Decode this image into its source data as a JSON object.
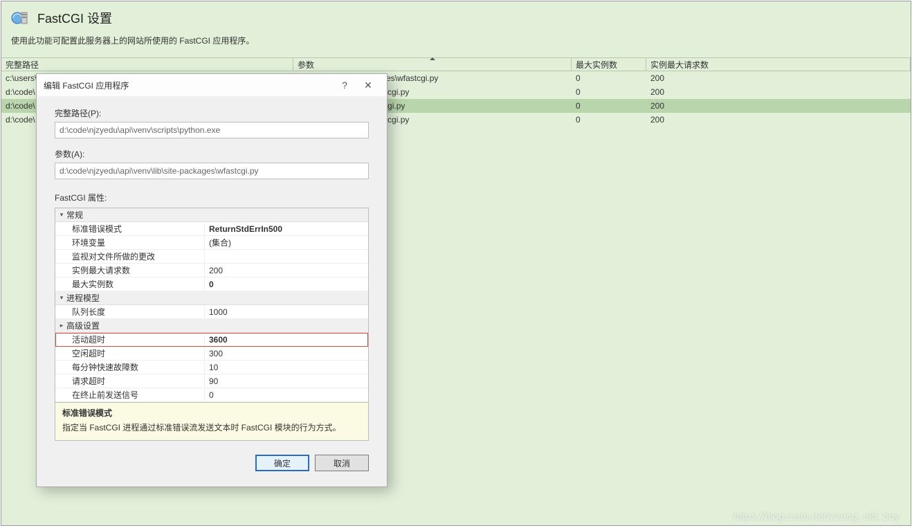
{
  "main": {
    "title": "FastCGI 设置",
    "description": "使用此功能可配置此服务器上的网站所使用的 FastCGI 应用程序。",
    "columns": [
      "完整路径",
      "参数",
      "最大实例数",
      "实例最大请求数"
    ],
    "sorted_col_index": 1,
    "rows": [
      {
        "path": "c:\\users\\",
        "args_suffix": "\\api\\venv\\lib\\site-packages\\wfastcgi.py",
        "max_instances": "0",
        "max_requests": "200",
        "selected": false
      },
      {
        "path": "d:\\code\\",
        "args_suffix": "v\\lib\\site-packages\\wfastcgi.py",
        "max_instances": "0",
        "max_requests": "200",
        "selected": false
      },
      {
        "path": "d:\\code\\",
        "args_suffix": "\\lib\\site-packages\\wfastcgi.py",
        "max_instances": "0",
        "max_requests": "200",
        "selected": true
      },
      {
        "path": "d:\\code\\",
        "args_suffix": "v\\lib\\site-packages\\wfastcgi.py",
        "max_instances": "0",
        "max_requests": "200",
        "selected": false
      }
    ]
  },
  "dialog": {
    "title": "编辑 FastCGI 应用程序",
    "help_glyph": "?",
    "close_glyph": "✕",
    "full_path_label": "完整路径(P):",
    "full_path_value": "d:\\code\\njzyedu\\api\\venv\\scripts\\python.exe",
    "args_label": "参数(A):",
    "args_value": "d:\\code\\njzyedu\\api\\venv\\lib\\site-packages\\wfastcgi.py",
    "props_label": "FastCGI 属性:",
    "cat_general": "常规",
    "cat_process": "进程模型",
    "cat_advanced": "高级设置",
    "props_general": [
      {
        "name": "标准错误模式",
        "value": "ReturnStdErrIn500",
        "bold": true
      },
      {
        "name": "环境变量",
        "value": "(集合)"
      },
      {
        "name": "监视对文件所做的更改",
        "value": ""
      },
      {
        "name": "实例最大请求数",
        "value": "200"
      },
      {
        "name": "最大实例数",
        "value": "0",
        "bold": true
      }
    ],
    "props_process": [
      {
        "name": "队列长度",
        "value": "1000"
      }
    ],
    "props_after_adv": [
      {
        "name": "活动超时",
        "value": "3600",
        "bold": true,
        "highlight": true
      },
      {
        "name": "空闲超时",
        "value": "300"
      },
      {
        "name": "每分钟快速故障数",
        "value": "10"
      },
      {
        "name": "请求超时",
        "value": "90"
      },
      {
        "name": "在终止前发送信号",
        "value": "0"
      }
    ],
    "desc_title": "标准错误模式",
    "desc_body": "指定当 FastCGI 进程通过标准错误流发送文本时 FastCGI 模块的行为方式。",
    "ok_label": "确定",
    "cancel_label": "取消"
  },
  "watermark": "https://blog.csdn.net/young_old_boy"
}
